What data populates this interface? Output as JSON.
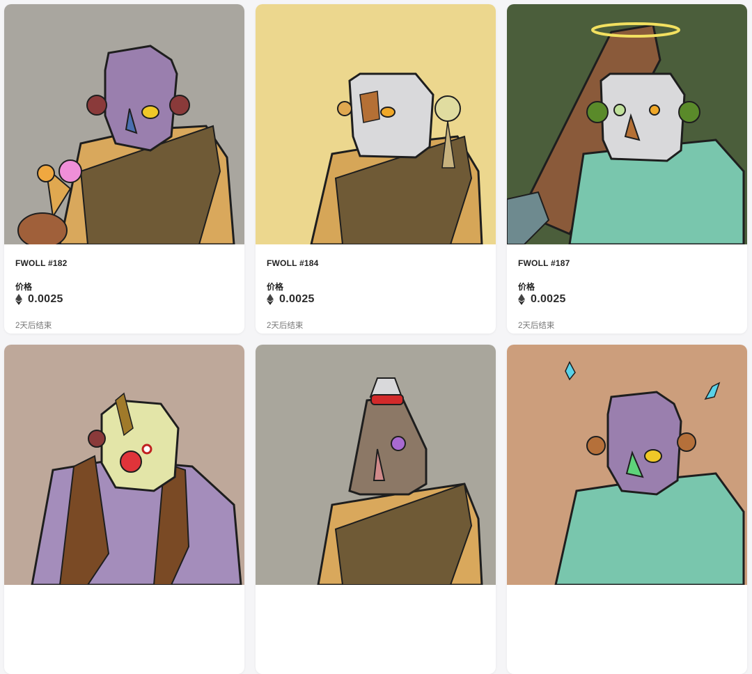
{
  "cards": [
    {
      "name": "FWOLL #182",
      "price_label": "价格",
      "price": "0.0025",
      "currency_icon": "ethereum-icon",
      "time_left": "2天后结束",
      "background": "#a9a69f",
      "skin": "#9a7fae",
      "body": "#d9a85c"
    },
    {
      "name": "FWOLL #184",
      "price_label": "价格",
      "price": "0.0025",
      "currency_icon": "ethereum-icon",
      "time_left": "2天后结束",
      "background": "#ecd78e",
      "skin": "#d9d9db",
      "body": "#d6a658"
    },
    {
      "name": "FWOLL #187",
      "price_label": "价格",
      "price": "0.0025",
      "currency_icon": "ethereum-icon",
      "time_left": "2天后结束",
      "background": "#4b5e3b",
      "skin": "#d9d9db",
      "body": "#79c6ad"
    },
    {
      "name": "",
      "price_label": "",
      "price": "",
      "time_left": "",
      "background": "#bea89a",
      "skin": "#e3e5a8",
      "body": "#a48dbb"
    },
    {
      "name": "",
      "price_label": "",
      "price": "",
      "time_left": "",
      "background": "#a9a69c",
      "skin": "#8c7866",
      "body": "#d9a85c"
    },
    {
      "name": "",
      "price_label": "",
      "price": "",
      "time_left": "",
      "background": "#cc9e7c",
      "skin": "#9a7fae",
      "body": "#79c6ad"
    }
  ]
}
